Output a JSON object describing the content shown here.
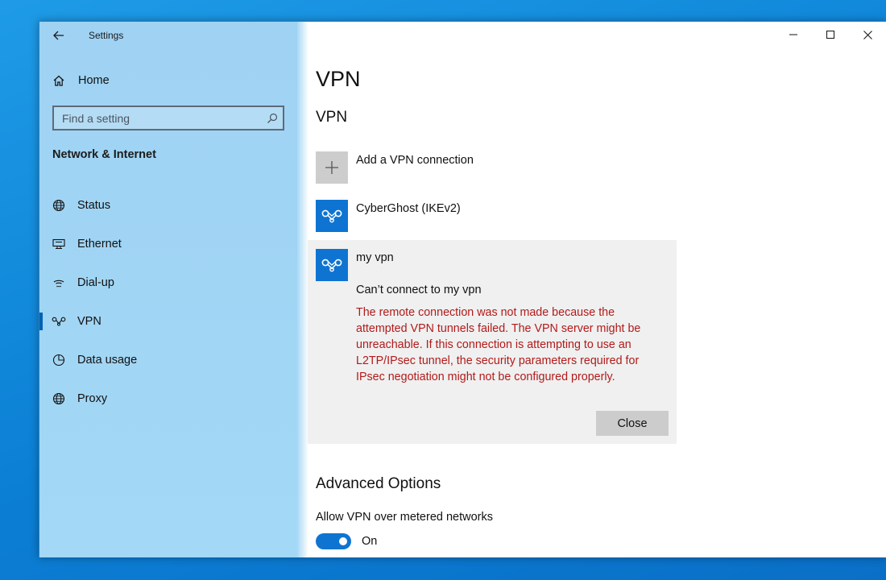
{
  "window": {
    "title": "Settings"
  },
  "sidebar": {
    "home_label": "Home",
    "search_placeholder": "Find a setting",
    "section_title": "Network & Internet",
    "items": [
      {
        "label": "Status",
        "icon": "globe-icon"
      },
      {
        "label": "Ethernet",
        "icon": "ethernet-icon"
      },
      {
        "label": "Dial-up",
        "icon": "dialup-icon"
      },
      {
        "label": "VPN",
        "icon": "vpn-icon",
        "active": true
      },
      {
        "label": "Data usage",
        "icon": "data-usage-icon"
      },
      {
        "label": "Proxy",
        "icon": "globe-icon"
      }
    ]
  },
  "main": {
    "page_title": "VPN",
    "section_title": "VPN",
    "add_connection_label": "Add a VPN connection",
    "connections": [
      {
        "name": "CyberGhost (IKEv2)"
      },
      {
        "name": "my vpn"
      }
    ],
    "error_card": {
      "status": "Can’t connect to my vpn",
      "message": "The remote connection was not made because the attempted VPN tunnels failed. The VPN server might be unreachable. If this connection is attempting to use an L2TP/IPsec tunnel, the security parameters required for IPsec negotiation might not be configured properly.",
      "close_label": "Close"
    },
    "advanced": {
      "title": "Advanced Options",
      "option_label": "Allow VPN over metered networks",
      "toggle_state": "On"
    }
  },
  "colors": {
    "accent": "#0f74d1",
    "error_text": "#b31a1a",
    "sidebar_bg": "#a3d8f6"
  }
}
